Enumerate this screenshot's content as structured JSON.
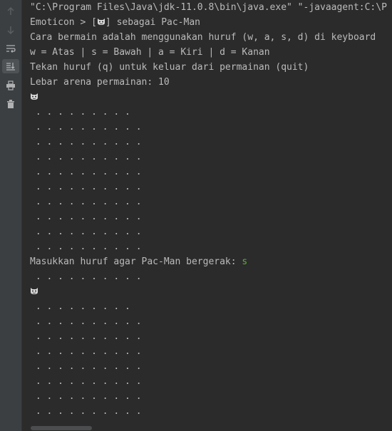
{
  "toolbar": {
    "icons": [
      "arrow-up-icon",
      "arrow-down-icon",
      "soft-wrap-icon",
      "scroll-to-end-icon",
      "print-icon",
      "trash-icon"
    ]
  },
  "console": {
    "command": "\"C:\\Program Files\\Java\\jdk-11.0.8\\bin\\java.exe\" \"-javaagent:C:\\P",
    "emoticon_prefix": "Emoticon > [",
    "emoticon_suffix": "] sebagai Pac-Man",
    "instruction": "Cara bermain adalah menggunakan huruf (w, a, s, d) di keyboard",
    "directions": "w = Atas | s = Bawah | a = Kiri | d = Kanan",
    "quit": "Tekan huruf (q) untuk keluar dari permainan (quit)",
    "arena_width": "Lebar arena permainan: 10",
    "grid1": [
      " . . . . . . . . .",
      " . . . . . . . . . .",
      " . . . . . . . . . .",
      " . . . . . . . . . .",
      " . . . . . . . . . .",
      " . . . . . . . . . .",
      " . . . . . . . . . .",
      " . . . . . . . . . .",
      " . . . . . . . . . .",
      " . . . . . . . . . ."
    ],
    "prompt": "Masukkan huruf agar Pac-Man bergerak: ",
    "user_input": "s",
    "grid2_top": " . . . . . . . . . .",
    "grid2": [
      " . . . . . . . . .",
      " . . . . . . . . . .",
      " . . . . . . . . . .",
      " . . . . . . . . . .",
      " . . . . . . . . . .",
      " . . . . . . . . . .",
      " . . . . . . . . . .",
      " . . . . . . . . . ."
    ]
  },
  "colors": {
    "background": "#2b2b2b",
    "text": "#bbbbbb",
    "input": "#5bb03b"
  }
}
